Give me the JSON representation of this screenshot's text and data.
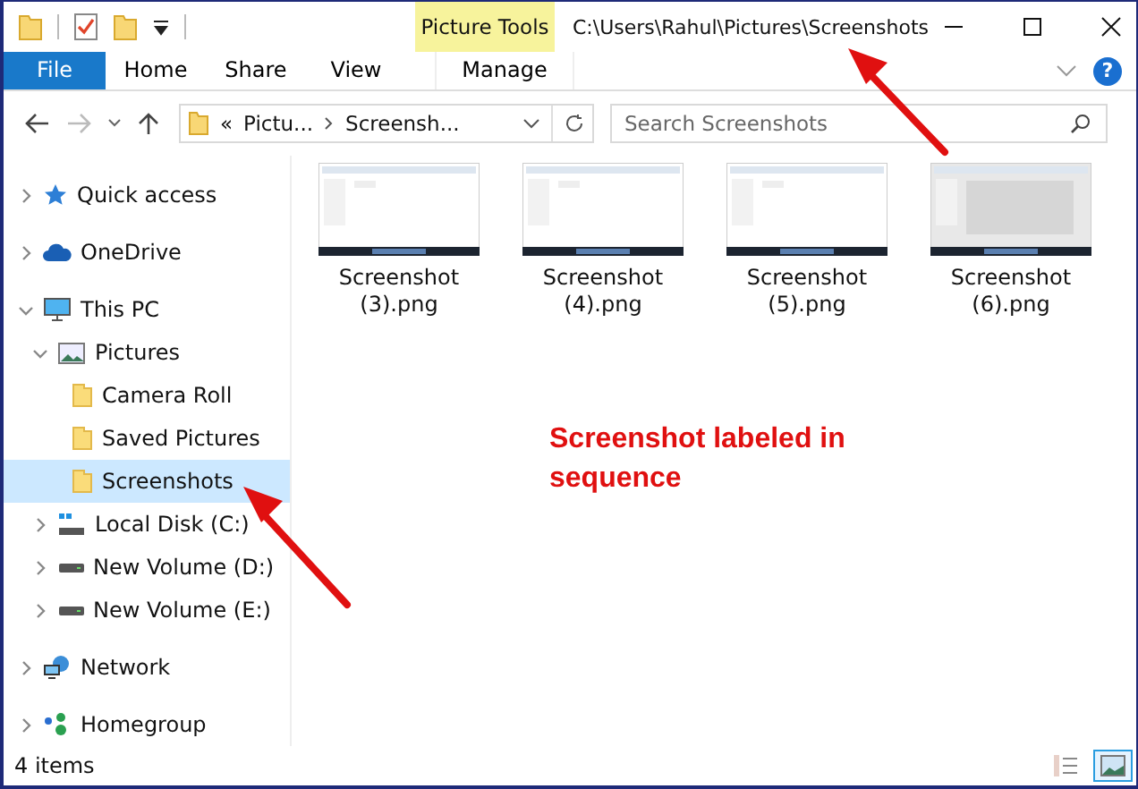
{
  "window": {
    "title": "C:\\Users\\Rahul\\Pictures\\Screenshots",
    "context_tab": "Picture Tools"
  },
  "ribbon": {
    "tabs": [
      {
        "label": "File",
        "kind": "file"
      },
      {
        "label": "Home",
        "kind": "plain"
      },
      {
        "label": "Share",
        "kind": "plain"
      },
      {
        "label": "View",
        "kind": "plain"
      },
      {
        "label": "Manage",
        "kind": "context"
      }
    ],
    "help": "?"
  },
  "address": {
    "overflow": "«",
    "segments": [
      "Pictu...",
      "Screensh..."
    ]
  },
  "search": {
    "placeholder": "Search Screenshots"
  },
  "nav": {
    "items": [
      {
        "label": "Quick access",
        "kind": "star",
        "expanded": false,
        "selected": false
      },
      {
        "label": "OneDrive",
        "kind": "cloud",
        "expanded": false,
        "selected": false
      },
      {
        "label": "This PC",
        "kind": "pc",
        "expanded": true,
        "selected": false,
        "children": [
          {
            "label": "Pictures",
            "kind": "pictures",
            "expanded": true,
            "selected": false,
            "children": [
              {
                "label": "Camera Roll",
                "kind": "folder",
                "selected": false
              },
              {
                "label": "Saved Pictures",
                "kind": "folder",
                "selected": false
              },
              {
                "label": "Screenshots",
                "kind": "folder",
                "selected": true
              }
            ]
          },
          {
            "label": "Local Disk (C:)",
            "kind": "system-drive",
            "expanded": false,
            "selected": false
          },
          {
            "label": "New Volume (D:)",
            "kind": "drive",
            "expanded": false,
            "selected": false
          },
          {
            "label": "New Volume (E:)",
            "kind": "drive",
            "expanded": false,
            "selected": false
          }
        ]
      },
      {
        "label": "Network",
        "kind": "network",
        "expanded": false,
        "selected": false
      },
      {
        "label": "Homegroup",
        "kind": "homegroup",
        "expanded": false,
        "selected": false
      }
    ]
  },
  "files": [
    {
      "name": "Screenshot (3).png"
    },
    {
      "name": "Screenshot (4).png"
    },
    {
      "name": "Screenshot (5).png"
    },
    {
      "name": "Screenshot (6).png"
    }
  ],
  "annotation": "Screenshot labeled in sequence",
  "status_bar": {
    "count": "4 items",
    "views": [
      {
        "kind": "details",
        "selected": false
      },
      {
        "kind": "large-icons",
        "selected": true
      }
    ]
  }
}
